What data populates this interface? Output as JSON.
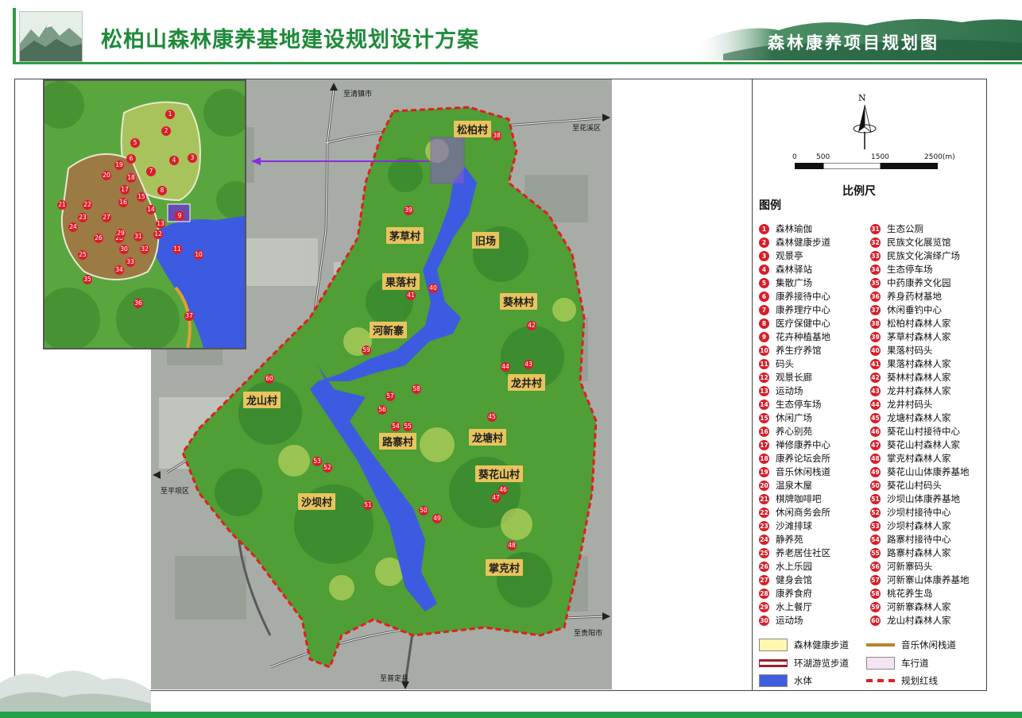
{
  "header": {
    "title": "松柏山森林康养基地建设规划设计方案",
    "section_title": "森林康养项目规划图"
  },
  "map": {
    "destinations": {
      "north": "至清镇市",
      "northeast": "至花溪区",
      "west": "至平坝区",
      "southeast": "至贵阳市",
      "south": "至普定县"
    },
    "villages": [
      {
        "name": "松柏村"
      },
      {
        "name": "茅草村"
      },
      {
        "name": "旧场"
      },
      {
        "name": "果落村"
      },
      {
        "name": "葵林村"
      },
      {
        "name": "河新寨"
      },
      {
        "name": "龙井村"
      },
      {
        "name": "龙山村"
      },
      {
        "name": "路寨村"
      },
      {
        "name": "龙塘村"
      },
      {
        "name": "葵花山村"
      },
      {
        "name": "沙坝村"
      },
      {
        "name": "掌克村"
      }
    ],
    "pins": [
      "38",
      "39",
      "40",
      "41",
      "42",
      "43",
      "44",
      "45",
      "46",
      "47",
      "48",
      "49",
      "50",
      "51",
      "52",
      "53",
      "54",
      "55",
      "56",
      "57",
      "58",
      "59",
      "60"
    ],
    "inset_pins": [
      "1",
      "2",
      "3",
      "4",
      "5",
      "6",
      "7",
      "8",
      "9",
      "10",
      "11",
      "12",
      "13",
      "14",
      "15",
      "16",
      "17",
      "18",
      "19",
      "20",
      "21",
      "22",
      "23",
      "24",
      "25",
      "26",
      "27",
      "28",
      "29",
      "30",
      "31",
      "32",
      "33",
      "34",
      "35",
      "36",
      "37"
    ]
  },
  "legend": {
    "north": "N",
    "scale_ticks": [
      "0",
      "500",
      "1500",
      "2500(m)"
    ],
    "scale_title": "比例尺",
    "title": "图例",
    "items_left": [
      {
        "n": "1",
        "label": "森林瑜伽"
      },
      {
        "n": "2",
        "label": "森林健康步道"
      },
      {
        "n": "3",
        "label": "观景亭"
      },
      {
        "n": "4",
        "label": "森林驿站"
      },
      {
        "n": "5",
        "label": "集散广场"
      },
      {
        "n": "6",
        "label": "康养接待中心"
      },
      {
        "n": "7",
        "label": "康养理疗中心"
      },
      {
        "n": "8",
        "label": "医疗保健中心"
      },
      {
        "n": "9",
        "label": "花卉种植基地"
      },
      {
        "n": "10",
        "label": "养生疗养馆"
      },
      {
        "n": "11",
        "label": "码头"
      },
      {
        "n": "12",
        "label": "观景长廊"
      },
      {
        "n": "13",
        "label": "运动场"
      },
      {
        "n": "14",
        "label": "生态停车场"
      },
      {
        "n": "15",
        "label": "休闲广场"
      },
      {
        "n": "16",
        "label": "养心别苑"
      },
      {
        "n": "17",
        "label": "禅修康养中心"
      },
      {
        "n": "18",
        "label": "康养论坛会所"
      },
      {
        "n": "19",
        "label": "音乐休闲栈道"
      },
      {
        "n": "20",
        "label": "温泉木屋"
      },
      {
        "n": "21",
        "label": "棋牌咖啡吧"
      },
      {
        "n": "22",
        "label": "休闲商务会所"
      },
      {
        "n": "23",
        "label": "沙滩排球"
      },
      {
        "n": "24",
        "label": "静养苑"
      },
      {
        "n": "25",
        "label": "养老居住社区"
      },
      {
        "n": "26",
        "label": "水上乐园"
      },
      {
        "n": "27",
        "label": "健身会馆"
      },
      {
        "n": "28",
        "label": "康养食府"
      },
      {
        "n": "29",
        "label": "水上餐厅"
      },
      {
        "n": "30",
        "label": "运动场"
      }
    ],
    "items_right": [
      {
        "n": "31",
        "label": "生态公厕"
      },
      {
        "n": "32",
        "label": "民族文化展览馆"
      },
      {
        "n": "33",
        "label": "民族文化演绎广场"
      },
      {
        "n": "34",
        "label": "生态停车场"
      },
      {
        "n": "35",
        "label": "中药康养文化园"
      },
      {
        "n": "36",
        "label": "养身药材基地"
      },
      {
        "n": "37",
        "label": "休闲垂钓中心"
      },
      {
        "n": "38",
        "label": "松柏村森林人家"
      },
      {
        "n": "39",
        "label": "茅草村森林人家"
      },
      {
        "n": "40",
        "label": "果落村码头"
      },
      {
        "n": "41",
        "label": "果落村森林人家"
      },
      {
        "n": "42",
        "label": "葵林村森林人家"
      },
      {
        "n": "43",
        "label": "龙井村森林人家"
      },
      {
        "n": "44",
        "label": "龙井村码头"
      },
      {
        "n": "45",
        "label": "龙塘村森林人家"
      },
      {
        "n": "46",
        "label": "葵花山村接待中心"
      },
      {
        "n": "47",
        "label": "葵花山村森林人家"
      },
      {
        "n": "48",
        "label": "掌克村森林人家"
      },
      {
        "n": "49",
        "label": "葵花山山体康养基地"
      },
      {
        "n": "50",
        "label": "葵花山村码头"
      },
      {
        "n": "51",
        "label": "沙坝山体康养基地"
      },
      {
        "n": "52",
        "label": "沙坝村接待中心"
      },
      {
        "n": "53",
        "label": "沙坝村森林人家"
      },
      {
        "n": "54",
        "label": "路寨村接待中心"
      },
      {
        "n": "55",
        "label": "路寨村森林人家"
      },
      {
        "n": "56",
        "label": "河新寨码头"
      },
      {
        "n": "57",
        "label": "河新寨山体康养基地"
      },
      {
        "n": "58",
        "label": "桃花养生岛"
      },
      {
        "n": "59",
        "label": "河新寨森林人家"
      },
      {
        "n": "60",
        "label": "龙山村森林人家"
      }
    ],
    "symbols": [
      {
        "label": "森林健康步道",
        "color": "#fff7b0"
      },
      {
        "label": "音乐休闲栈道",
        "color": "#b9842c"
      },
      {
        "label": "环湖游览步道",
        "color": "#a11d2a"
      },
      {
        "label": "车行道",
        "color": "#f3e3f3"
      },
      {
        "label": "水体",
        "color": "#3f5fe0"
      },
      {
        "label": "规划红线",
        "color": "#e01e1e"
      }
    ]
  }
}
